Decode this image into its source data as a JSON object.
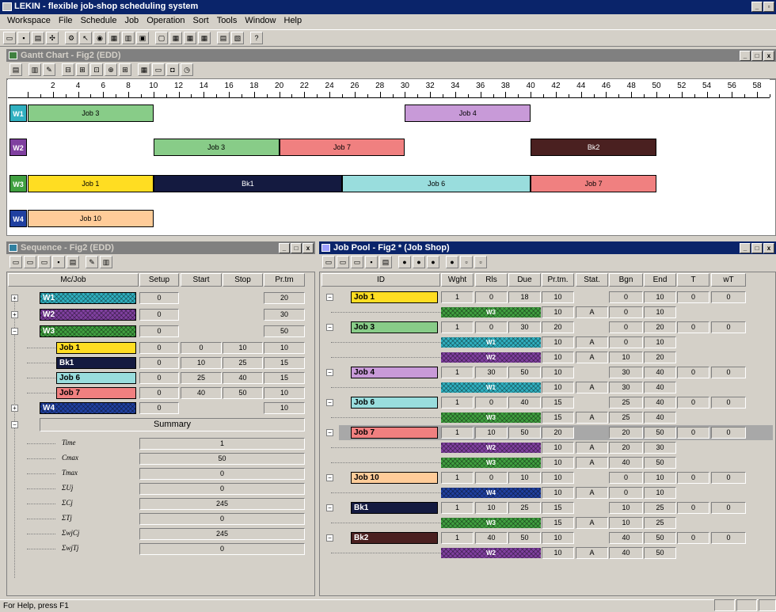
{
  "app": {
    "title": "LEKIN - flexible job-shop scheduling system"
  },
  "menu": [
    "Workspace",
    "File",
    "Schedule",
    "Job",
    "Operation",
    "Sort",
    "Tools",
    "Window",
    "Help"
  ],
  "gantt": {
    "title": "Gantt Chart - Fig2 (EDD)",
    "ticks": [
      "2",
      "4",
      "6",
      "8",
      "10",
      "12",
      "14",
      "16",
      "18",
      "20",
      "22",
      "24",
      "26",
      "28",
      "30",
      "32",
      "34",
      "36",
      "38",
      "40",
      "42",
      "44",
      "46",
      "48",
      "50",
      "52",
      "54",
      "56",
      "58"
    ],
    "machines": [
      "W1",
      "W2",
      "W3",
      "W4"
    ],
    "bars": [
      {
        "m": 0,
        "s": 0,
        "e": 10,
        "label": "Job 3",
        "color": "#88cc88"
      },
      {
        "m": 0,
        "s": 30,
        "e": 40,
        "label": "Job 4",
        "color": "#c89ad8"
      },
      {
        "m": 1,
        "s": 10,
        "e": 20,
        "label": "Job 3",
        "color": "#88cc88"
      },
      {
        "m": 1,
        "s": 20,
        "e": 30,
        "label": "Job 7",
        "color": "#f08080"
      },
      {
        "m": 1,
        "s": 40,
        "e": 50,
        "label": "Bk2",
        "color": "#4a2020",
        "dark": true
      },
      {
        "m": 2,
        "s": 0,
        "e": 10,
        "label": "Job 1",
        "color": "#ffdd22"
      },
      {
        "m": 2,
        "s": 10,
        "e": 25,
        "label": "Bk1",
        "color": "#141a40",
        "dark": true
      },
      {
        "m": 2,
        "s": 25,
        "e": 40,
        "label": "Job 6",
        "color": "#99dddd"
      },
      {
        "m": 2,
        "s": 40,
        "e": 50,
        "label": "Job 7",
        "color": "#f08080"
      },
      {
        "m": 3,
        "s": 0,
        "e": 10,
        "label": "Job 10",
        "color": "#ffcc99"
      }
    ]
  },
  "sequence": {
    "title": "Sequence - Fig2 (EDD)",
    "headers": [
      "Mc/Job",
      "Setup",
      "Start",
      "Stop",
      "Pr.tm"
    ],
    "rows": [
      {
        "kind": "m",
        "name": "W1",
        "color": "#30b0c0",
        "setup": "0",
        "start": "",
        "stop": "",
        "prtm": "20"
      },
      {
        "kind": "m",
        "name": "W2",
        "color": "#8040a0",
        "setup": "0",
        "start": "",
        "stop": "",
        "prtm": "30"
      },
      {
        "kind": "m",
        "name": "W3",
        "color": "#40a040",
        "setup": "0",
        "start": "",
        "stop": "",
        "prtm": "50"
      },
      {
        "kind": "j",
        "name": "Job 1",
        "color": "#ffdd22",
        "setup": "0",
        "start": "0",
        "stop": "10",
        "prtm": "10"
      },
      {
        "kind": "j",
        "name": "Bk1",
        "color": "#141a40",
        "dark": true,
        "setup": "0",
        "start": "10",
        "stop": "25",
        "prtm": "15"
      },
      {
        "kind": "j",
        "name": "Job 6",
        "color": "#99dddd",
        "setup": "0",
        "start": "25",
        "stop": "40",
        "prtm": "15"
      },
      {
        "kind": "j",
        "name": "Job 7",
        "color": "#f08080",
        "setup": "0",
        "start": "40",
        "stop": "50",
        "prtm": "10"
      },
      {
        "kind": "m",
        "name": "W4",
        "color": "#2040a0",
        "setup": "0",
        "start": "",
        "stop": "",
        "prtm": "10"
      }
    ],
    "summary_label": "Summary",
    "summary": [
      {
        "k": "Time",
        "v": "1"
      },
      {
        "k": "Cmax",
        "v": "50"
      },
      {
        "k": "Tmax",
        "v": "0"
      },
      {
        "k": "ΣUj",
        "v": "0"
      },
      {
        "k": "ΣCj",
        "v": "245"
      },
      {
        "k": "ΣTj",
        "v": "0"
      },
      {
        "k": "ΣwjCj",
        "v": "245"
      },
      {
        "k": "ΣwjTj",
        "v": "0"
      }
    ]
  },
  "jobpool": {
    "title": "Job Pool - Fig2 * (Job Shop)",
    "headers": [
      "ID",
      "Wght",
      "Rls",
      "Due",
      "Pr.tm.",
      "Stat.",
      "Bgn",
      "End",
      "T",
      "wT"
    ],
    "jobs": [
      {
        "id": "Job 1",
        "color": "#ffdd22",
        "w": "1",
        "r": "0",
        "d": "18",
        "p": "10",
        "b": "0",
        "e": "10",
        "t": "0",
        "wt": "0",
        "ops": [
          {
            "m": "W3",
            "mc": "#40a040",
            "p": "10",
            "s": "A",
            "b": "0",
            "e": "10"
          }
        ]
      },
      {
        "id": "Job 3",
        "color": "#88cc88",
        "w": "1",
        "r": "0",
        "d": "30",
        "p": "20",
        "b": "0",
        "e": "20",
        "t": "0",
        "wt": "0",
        "ops": [
          {
            "m": "W1",
            "mc": "#30b0c0",
            "p": "10",
            "s": "A",
            "b": "0",
            "e": "10"
          },
          {
            "m": "W2",
            "mc": "#8040a0",
            "p": "10",
            "s": "A",
            "b": "10",
            "e": "20"
          }
        ]
      },
      {
        "id": "Job 4",
        "color": "#c89ad8",
        "w": "1",
        "r": "30",
        "d": "50",
        "p": "10",
        "b": "30",
        "e": "40",
        "t": "0",
        "wt": "0",
        "ops": [
          {
            "m": "W1",
            "mc": "#30b0c0",
            "p": "10",
            "s": "A",
            "b": "30",
            "e": "40"
          }
        ]
      },
      {
        "id": "Job 6",
        "color": "#99dddd",
        "w": "1",
        "r": "0",
        "d": "40",
        "p": "15",
        "b": "25",
        "e": "40",
        "t": "0",
        "wt": "0",
        "ops": [
          {
            "m": "W3",
            "mc": "#40a040",
            "p": "15",
            "s": "A",
            "b": "25",
            "e": "40"
          }
        ]
      },
      {
        "id": "Job 7",
        "color": "#f08080",
        "w": "1",
        "r": "10",
        "d": "50",
        "p": "20",
        "b": "20",
        "e": "50",
        "t": "0",
        "wt": "0",
        "sel": true,
        "ops": [
          {
            "m": "W2",
            "mc": "#8040a0",
            "p": "10",
            "s": "A",
            "b": "20",
            "e": "30"
          },
          {
            "m": "W3",
            "mc": "#40a040",
            "p": "10",
            "s": "A",
            "b": "40",
            "e": "50"
          }
        ]
      },
      {
        "id": "Job 10",
        "color": "#ffcc99",
        "w": "1",
        "r": "0",
        "d": "10",
        "p": "10",
        "b": "0",
        "e": "10",
        "t": "0",
        "wt": "0",
        "ops": [
          {
            "m": "W4",
            "mc": "#2040a0",
            "p": "10",
            "s": "A",
            "b": "0",
            "e": "10"
          }
        ]
      },
      {
        "id": "Bk1",
        "color": "#141a40",
        "dark": true,
        "w": "1",
        "r": "10",
        "d": "25",
        "p": "15",
        "b": "10",
        "e": "25",
        "t": "0",
        "wt": "0",
        "ops": [
          {
            "m": "W3",
            "mc": "#40a040",
            "p": "15",
            "s": "A",
            "b": "10",
            "e": "25"
          }
        ]
      },
      {
        "id": "Bk2",
        "color": "#4a2020",
        "dark": true,
        "w": "1",
        "r": "40",
        "d": "50",
        "p": "10",
        "b": "40",
        "e": "50",
        "t": "0",
        "wt": "0",
        "ops": [
          {
            "m": "W2",
            "mc": "#8040a0",
            "p": "10",
            "s": "A",
            "b": "40",
            "e": "50"
          }
        ]
      }
    ]
  },
  "statusbar": {
    "text": "For Help, press F1"
  }
}
